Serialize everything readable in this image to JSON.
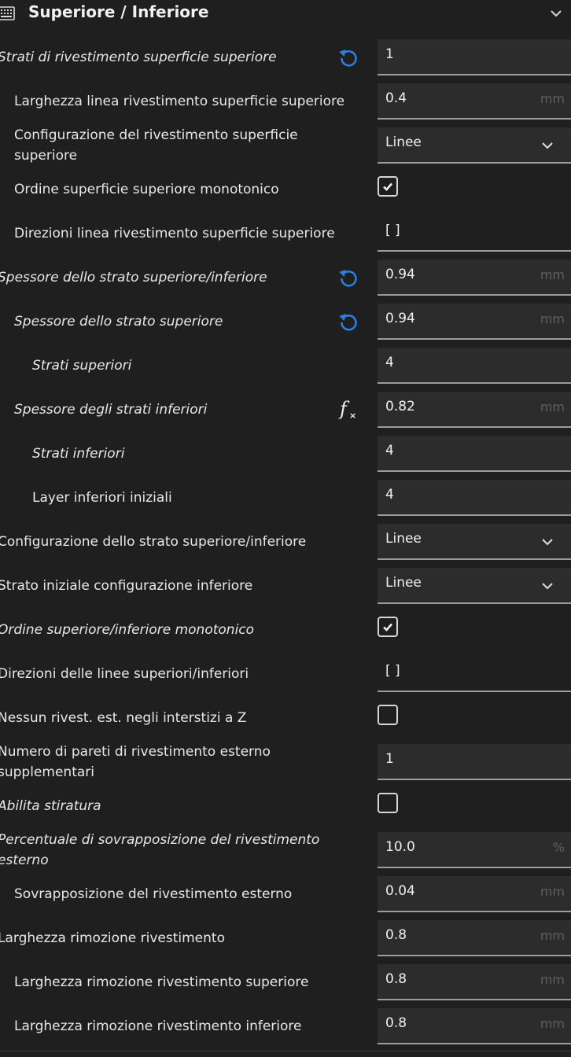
{
  "section": {
    "title": "Superiore / Inferiore",
    "icon": "layers-grid-icon",
    "collapse_icon": "chevron-down-icon"
  },
  "colors": {
    "background": "#1f1f1f",
    "field_background": "#2c2c2c",
    "reset_icon": "#2b7fe0",
    "unit_text": "#5f5f5f"
  },
  "settings": [
    {
      "label": "Strati di rivestimento superficie superiore",
      "value": "1",
      "unit": "",
      "type": "input",
      "italic": true,
      "indent": 0,
      "aux": "reset"
    },
    {
      "label": "Larghezza linea rivestimento superficie superiore",
      "value": "0.4",
      "unit": "mm",
      "type": "input",
      "italic": false,
      "indent": 1,
      "aux": ""
    },
    {
      "label": "Configurazione del rivestimento superficie superiore",
      "value": "Linee",
      "unit": "",
      "type": "select",
      "italic": false,
      "indent": 1,
      "aux": ""
    },
    {
      "label": "Ordine superficie superiore monotonico",
      "value": "checked",
      "unit": "",
      "type": "checkbox",
      "italic": false,
      "indent": 1,
      "aux": ""
    },
    {
      "label": "Direzioni linea rivestimento superficie superiore",
      "value": "[ ]",
      "unit": "",
      "type": "text",
      "italic": false,
      "indent": 1,
      "aux": ""
    },
    {
      "label": "Spessore dello strato superiore/inferiore",
      "value": "0.94",
      "unit": "mm",
      "type": "input",
      "italic": true,
      "indent": 0,
      "aux": "reset"
    },
    {
      "label": "Spessore dello strato superiore",
      "value": "0.94",
      "unit": "mm",
      "type": "input",
      "italic": true,
      "indent": 1,
      "aux": "reset"
    },
    {
      "label": "Strati superiori",
      "value": "4",
      "unit": "",
      "type": "input",
      "italic": true,
      "indent": 2,
      "aux": ""
    },
    {
      "label": "Spessore degli strati inferiori",
      "value": "0.82",
      "unit": "mm",
      "type": "input",
      "italic": true,
      "indent": 1,
      "aux": "function"
    },
    {
      "label": "Strati inferiori",
      "value": "4",
      "unit": "",
      "type": "input",
      "italic": true,
      "indent": 2,
      "aux": ""
    },
    {
      "label": "Layer inferiori iniziali",
      "value": "4",
      "unit": "",
      "type": "input",
      "italic": false,
      "indent": 2,
      "aux": ""
    },
    {
      "label": "Configurazione dello strato superiore/inferiore",
      "value": "Linee",
      "unit": "",
      "type": "select",
      "italic": false,
      "indent": 0,
      "aux": ""
    },
    {
      "label": "Strato iniziale configurazione inferiore",
      "value": "Linee",
      "unit": "",
      "type": "select",
      "italic": false,
      "indent": 0,
      "aux": ""
    },
    {
      "label": "Ordine superiore/inferiore monotonico",
      "value": "checked",
      "unit": "",
      "type": "checkbox",
      "italic": true,
      "indent": 0,
      "aux": ""
    },
    {
      "label": "Direzioni delle linee superiori/inferiori",
      "value": "[ ]",
      "unit": "",
      "type": "text",
      "italic": false,
      "indent": 0,
      "aux": ""
    },
    {
      "label": "Nessun rivest. est. negli interstizi a Z",
      "value": "unchecked",
      "unit": "",
      "type": "checkbox",
      "italic": false,
      "indent": 0,
      "aux": ""
    },
    {
      "label": "Numero di pareti di rivestimento esterno supplementari",
      "value": "1",
      "unit": "",
      "type": "input",
      "italic": false,
      "indent": 0,
      "aux": ""
    },
    {
      "label": "Abilita stiratura",
      "value": "unchecked",
      "unit": "",
      "type": "checkbox",
      "italic": true,
      "indent": 0,
      "aux": ""
    },
    {
      "label": "Percentuale di sovrapposizione del rivestimento esterno",
      "value": "10.0",
      "unit": "%",
      "type": "input",
      "italic": true,
      "indent": 0,
      "aux": ""
    },
    {
      "label": "Sovrapposizione del rivestimento esterno",
      "value": "0.04",
      "unit": "mm",
      "type": "input",
      "italic": false,
      "indent": 1,
      "aux": ""
    },
    {
      "label": "Larghezza rimozione rivestimento",
      "value": "0.8",
      "unit": "mm",
      "type": "input",
      "italic": false,
      "indent": 0,
      "aux": ""
    },
    {
      "label": "Larghezza rimozione rivestimento superiore",
      "value": "0.8",
      "unit": "mm",
      "type": "input",
      "italic": false,
      "indent": 1,
      "aux": ""
    },
    {
      "label": "Larghezza rimozione rivestimento inferiore",
      "value": "0.8",
      "unit": "mm",
      "type": "input",
      "italic": false,
      "indent": 1,
      "aux": ""
    }
  ]
}
